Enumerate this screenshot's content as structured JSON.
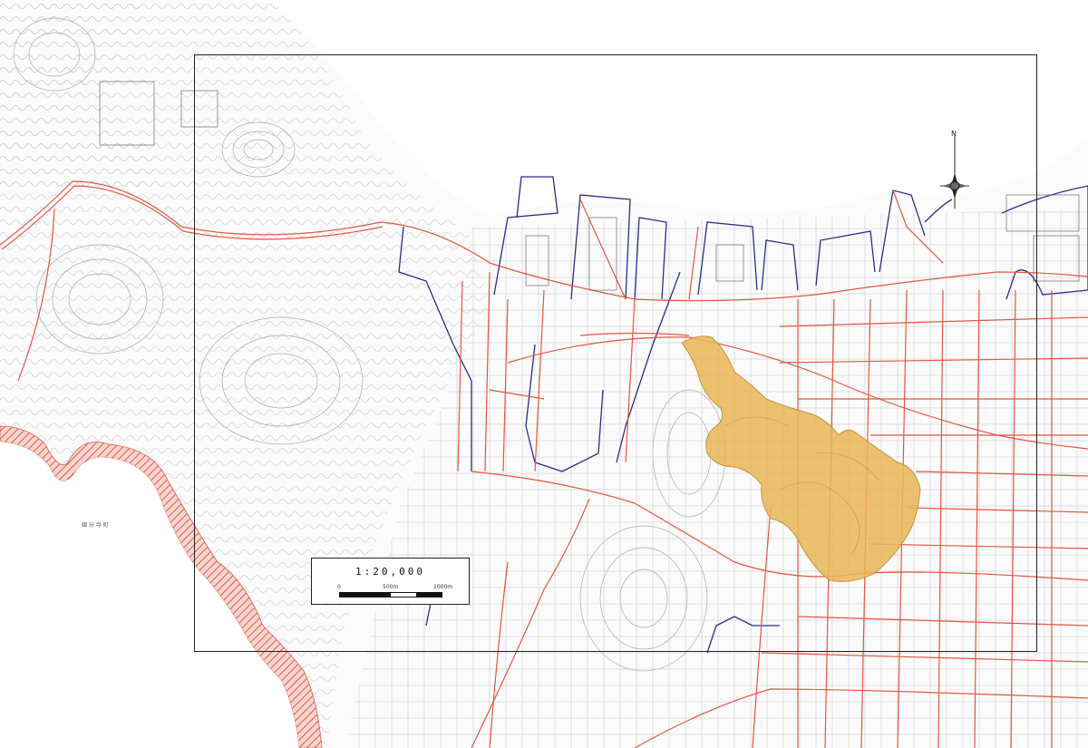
{
  "map": {
    "scale_text": "1:20,000",
    "scale_ticks": [
      "0",
      "500m",
      "1000m"
    ],
    "place_label": "國 分 寺 町",
    "north_label": "N"
  },
  "colors": {
    "background": "#fbfbfb",
    "sea": "#ffffff",
    "topo_lines": "#9aa3ad",
    "roads": "#e2573f",
    "districts": "#2a2d8a",
    "boundary": "#e05a4a",
    "highlight_area": "#e8b657",
    "frame": "#222222"
  }
}
